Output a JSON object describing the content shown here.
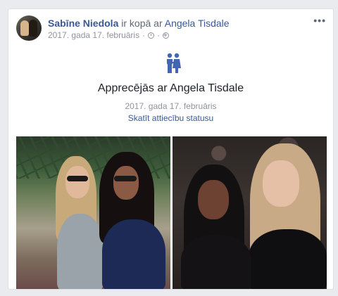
{
  "post": {
    "author": "Sabīne Niedola",
    "connector": " ir kopā ar ",
    "tagged": "Angela Tisdale",
    "date": "2017. gada 17. februāris",
    "separator": "·",
    "more_label": "•••"
  },
  "event": {
    "icon": "couple-icon",
    "title": "Apprecējās ar Angela Tisdale",
    "date": "2017. gada 17. februāris",
    "link": "Skatīt attiecību statusu"
  },
  "colors": {
    "link": "#385898",
    "meta": "#90949c",
    "icon_blue": "#4267b2"
  }
}
